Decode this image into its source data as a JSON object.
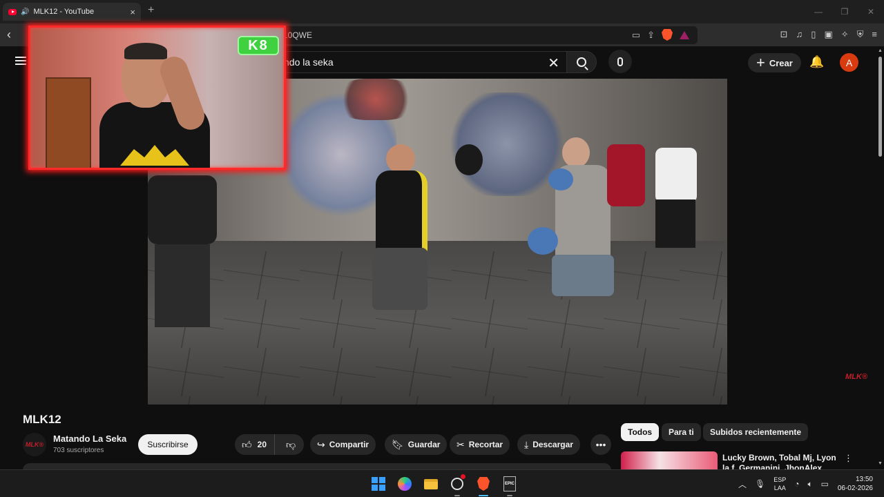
{
  "browser": {
    "tab_title": "MLK12 - YouTube",
    "tab_close": "×",
    "new_tab": "+",
    "url_fragment": "10QWE"
  },
  "header": {
    "search_value": "ndo la seka",
    "create_label": "Crear",
    "avatar_letter": "A"
  },
  "video": {
    "cam_logo": "K8",
    "watermark": "MLK®"
  },
  "channel": {
    "video_title": "MLK12",
    "avatar_text": "MLK®",
    "name": "Matando La Seka",
    "subscribers": "703 suscriptores",
    "subscribe_label": "Suscribirse"
  },
  "actions": {
    "like_count": "20",
    "share_label": "Compartir",
    "save_label": "Guardar",
    "clip_label": "Recortar",
    "download_label": "Descargar"
  },
  "chips": [
    "Todos",
    "Para ti",
    "Subidos recientemente"
  ],
  "related": {
    "title": "Lucky Brown, Tobal Mj, Lyon la f, Germanini, JhonAlex, Tony"
  },
  "taskbar": {
    "lang_line1": "ESP",
    "lang_line2": "LAA",
    "time": "13:50",
    "date": "06-02-2026",
    "epic_label": "EPIC"
  },
  "colors": {
    "accent_red": "#ff0033",
    "avatar": "#d93b10",
    "cam_border": "#ff2a2a"
  }
}
